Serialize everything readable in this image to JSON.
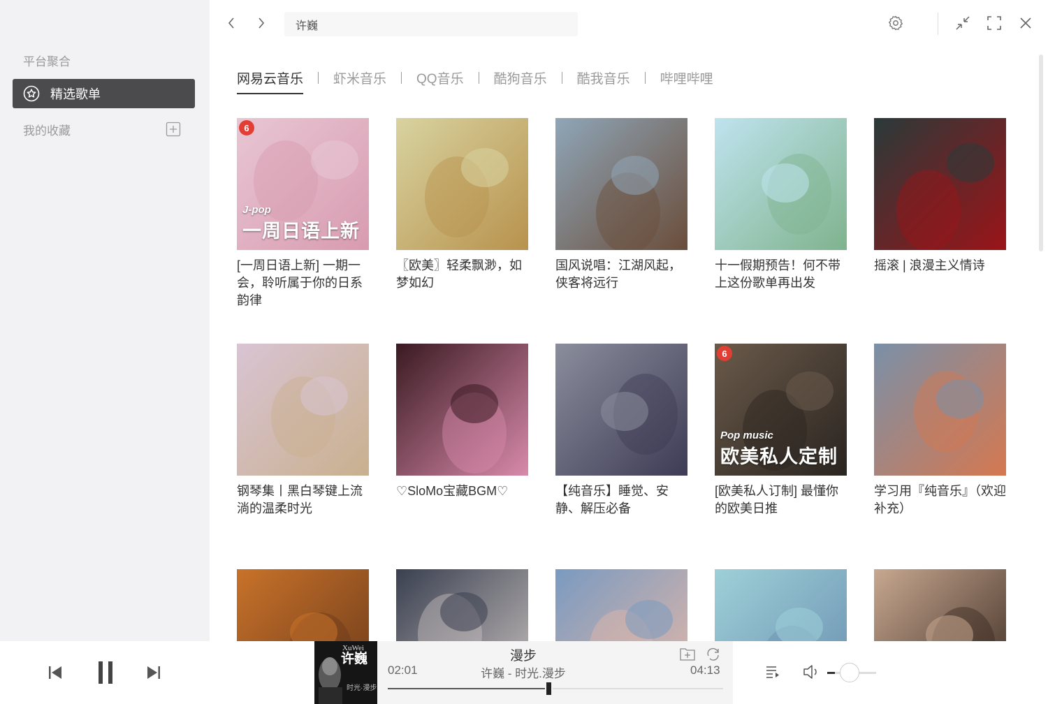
{
  "sidebar": {
    "group_label": "平台聚合",
    "active_item": "精选歌单",
    "favorites_label": "我的收藏"
  },
  "topbar": {
    "search_value": "许巍"
  },
  "tabs": [
    "网易云音乐",
    "虾米音乐",
    "QQ音乐",
    "酷狗音乐",
    "酷我音乐",
    "哔哩哔哩"
  ],
  "playlists": [
    {
      "title": "[一周日语上新] 一期一会，聆听属于你的日系韵律",
      "badge": "6",
      "cover_small": "J-pop",
      "cover_big": "一周日语上新",
      "colors": [
        "#e8c6d3",
        "#d89bb0"
      ]
    },
    {
      "title": "〖欧美〗轻柔飘渺，如梦如幻",
      "badge": "",
      "cover_small": "",
      "cover_big": "",
      "colors": [
        "#d8d3a0",
        "#b8924d"
      ]
    },
    {
      "title": "国风说唱：江湖风起，侠客将远行",
      "badge": "",
      "cover_small": "",
      "cover_big": "",
      "colors": [
        "#8fa6b8",
        "#6a4d3a"
      ]
    },
    {
      "title": "十一假期预告！何不带上这份歌单再出发",
      "badge": "",
      "cover_small": "",
      "cover_big": "",
      "colors": [
        "#bfe3ef",
        "#7fb38d"
      ]
    },
    {
      "title": "摇滚 | 浪漫主义情诗",
      "badge": "",
      "cover_small": "",
      "cover_big": "",
      "colors": [
        "#2a3a3a",
        "#9b1418"
      ]
    },
    {
      "title": "钢琴集丨黑白琴键上流淌的温柔时光",
      "badge": "",
      "cover_small": "",
      "cover_big": "",
      "colors": [
        "#d9c4d4",
        "#c9b08e"
      ]
    },
    {
      "title": "♡SloMo宝藏BGM♡",
      "badge": "",
      "cover_small": "",
      "cover_big": "",
      "colors": [
        "#3a1a22",
        "#d88aaa"
      ]
    },
    {
      "title": "【纯音乐】睡觉、安静、解压必备",
      "badge": "",
      "cover_small": "",
      "cover_big": "",
      "colors": [
        "#8a8e9c",
        "#3e3b55"
      ]
    },
    {
      "title": "[欧美私人订制] 最懂你的欧美日推",
      "badge": "6",
      "cover_small": "Pop music",
      "cover_big": "欧美私人定制",
      "colors": [
        "#6a5a4a",
        "#2a2420"
      ]
    },
    {
      "title": "学习用『纯音乐』（欢迎补充）",
      "badge": "",
      "cover_small": "",
      "cover_big": "",
      "colors": [
        "#7a90a8",
        "#d57850"
      ]
    },
    {
      "title": "",
      "badge": "",
      "cover_small": "",
      "cover_big": "",
      "colors": [
        "#c8722a",
        "#6b3a1a"
      ]
    },
    {
      "title": "",
      "badge": "",
      "cover_small": "",
      "cover_big": "",
      "colors": [
        "#3a4050",
        "#c9c2c0"
      ]
    },
    {
      "title": "",
      "badge": "",
      "cover_small": "",
      "cover_big": "",
      "colors": [
        "#7a9ac0",
        "#e4b8a8"
      ]
    },
    {
      "title": "",
      "badge": "",
      "cover_small": "",
      "cover_big": "",
      "colors": [
        "#9ed0d8",
        "#6a8fb0"
      ]
    },
    {
      "title": "",
      "badge": "",
      "cover_small": "",
      "cover_big": "",
      "colors": [
        "#c8a890",
        "#3a2a22"
      ]
    }
  ],
  "player": {
    "song_title": "漫步",
    "artist_album": "许巍 - 时光.漫步",
    "elapsed": "02:01",
    "total": "04:13",
    "progress": 0.48,
    "volume": 0.16,
    "cover_line1": "XuWei",
    "cover_line2": "许巍",
    "cover_line3": "时光·漫步"
  },
  "icons": {
    "back": "chevron-left-icon",
    "forward": "chevron-right-icon",
    "settings": "gear-icon",
    "minimize": "compress-icon",
    "maximize": "fullscreen-icon",
    "close": "close-icon",
    "star": "star-circle-icon",
    "add": "plus-box-icon",
    "prev": "skip-previous-icon",
    "pause": "pause-icon",
    "next": "skip-next-icon",
    "playlist": "queue-icon",
    "volume": "speaker-icon",
    "add_to": "add-to-folder-icon",
    "repeat": "repeat-icon"
  }
}
